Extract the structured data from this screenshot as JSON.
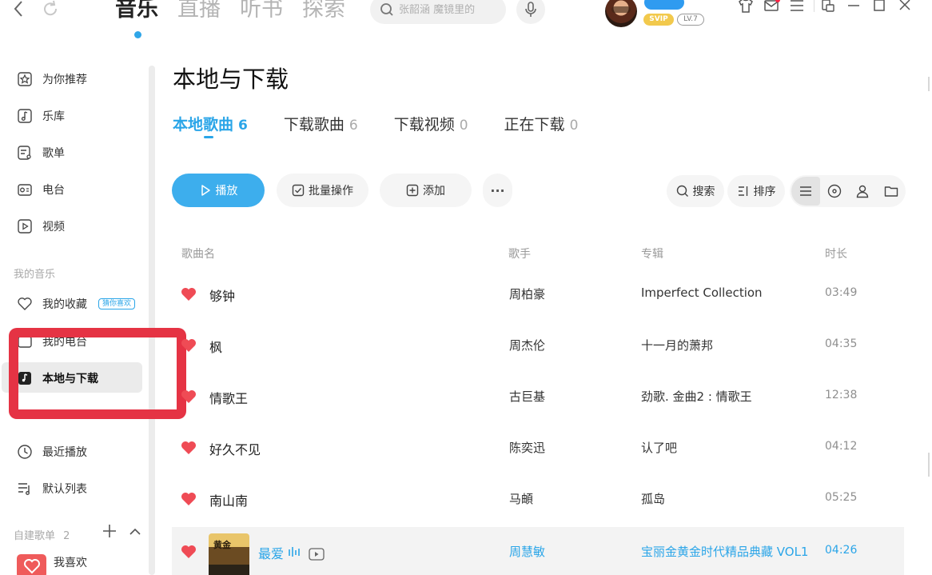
{
  "topbar": {
    "tabs": [
      "音乐",
      "直播",
      "听书",
      "探索"
    ],
    "active_tab": "音乐",
    "search_placeholder": "张韶涵 魔镜里的",
    "vip_badge": "SVIP",
    "level_badge": "LV.7"
  },
  "sidebar": {
    "items": [
      {
        "label": "为你推荐",
        "icon": "star-icon"
      },
      {
        "label": "乐库",
        "icon": "music-note-icon"
      },
      {
        "label": "歌单",
        "icon": "playlist-icon"
      },
      {
        "label": "电台",
        "icon": "radio-icon"
      },
      {
        "label": "视频",
        "icon": "video-icon"
      }
    ],
    "my_music_header": "我的音乐",
    "my_items": [
      {
        "label": "我的收藏",
        "icon": "heart-outline-icon",
        "tag": "猜你喜欢"
      },
      {
        "label": "我的电台",
        "icon": "radio-icon"
      },
      {
        "label": "本地与下载",
        "icon": "download-note-icon",
        "active": true
      },
      {
        "label": "最近播放",
        "icon": "clock-icon"
      },
      {
        "label": "默认列表",
        "icon": "list-icon"
      }
    ],
    "custom_playlists_header": "自建歌单",
    "custom_playlists_count": "2",
    "liked_label": "我喜欢"
  },
  "main": {
    "title": "本地与下载",
    "sub_tabs": [
      {
        "label": "本地歌曲",
        "count": "6",
        "active": true
      },
      {
        "label": "下载歌曲",
        "count": "6"
      },
      {
        "label": "下载视频",
        "count": "0"
      },
      {
        "label": "正在下载",
        "count": "0"
      }
    ],
    "toolbar": {
      "play": "播放",
      "batch": "批量操作",
      "add": "添加",
      "more": "···",
      "search": "搜索",
      "sort": "排序"
    },
    "columns": [
      "歌曲名",
      "歌手",
      "专辑",
      "时长"
    ],
    "rows": [
      {
        "title": "够钟",
        "singer": "周柏豪",
        "album": "Imperfect Collection",
        "duration": "03:49"
      },
      {
        "title": "枫",
        "singer": "周杰伦",
        "album": "十一月的萧邦",
        "duration": "04:35"
      },
      {
        "title": "情歌王",
        "singer": "古巨基",
        "album": "劲歌. 金曲2 : 情歌王",
        "duration": "12:38"
      },
      {
        "title": "好久不见",
        "singer": "陈奕迅",
        "album": "认了吧",
        "duration": "04:12"
      },
      {
        "title": "南山南",
        "singer": "马頔",
        "album": "孤岛",
        "duration": "05:25"
      },
      {
        "title": "最爱",
        "singer": "周慧敏",
        "album": "宝丽金黄金时代精品典藏 VOL1",
        "duration": "04:26",
        "cover_text": "黄金"
      }
    ]
  },
  "colors": {
    "accent": "#2aa5e8",
    "play_button": "#3daeed",
    "heart": "#ef4b55",
    "annotation_box": "#e53344"
  }
}
